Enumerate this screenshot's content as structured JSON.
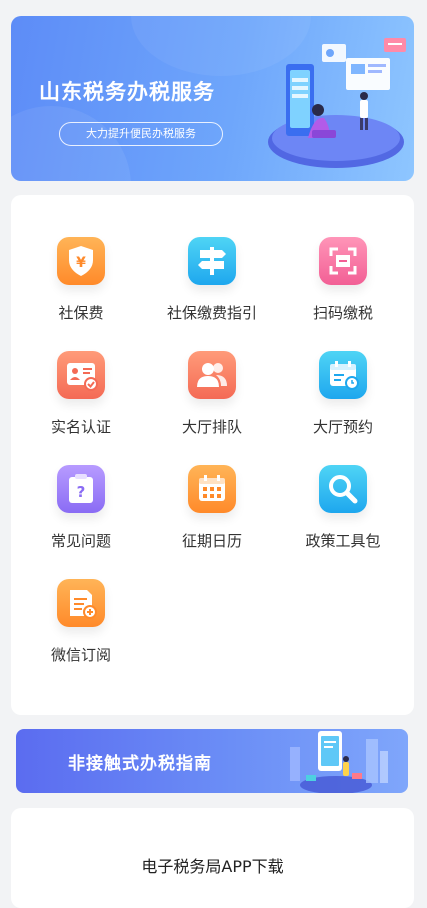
{
  "banner": {
    "title": "山东税务办税服务",
    "subtitle": "大力提升便民办税服务"
  },
  "services": [
    {
      "label": "社保费",
      "icon": "shield-yuan-icon",
      "color": "#ff9a3c"
    },
    {
      "label": "社保缴费指引",
      "icon": "signpost-icon",
      "color": "#2bb6f0"
    },
    {
      "label": "扫码缴税",
      "icon": "scan-icon",
      "color": "#f46fa0"
    },
    {
      "label": "实名认证",
      "icon": "id-card-icon",
      "color": "#f5785e"
    },
    {
      "label": "大厅排队",
      "icon": "people-icon",
      "color": "#f5785e"
    },
    {
      "label": "大厅预约",
      "icon": "calendar-clock-icon",
      "color": "#2bb6f0"
    },
    {
      "label": "常见问题",
      "icon": "question-icon",
      "color": "#9a7df8"
    },
    {
      "label": "征期日历",
      "icon": "calendar-icon",
      "color": "#ff9a3c"
    },
    {
      "label": "政策工具包",
      "icon": "magnifier-icon",
      "color": "#2bb6f0"
    },
    {
      "label": "微信订阅",
      "icon": "subscribe-doc-icon",
      "color": "#ff9a3c"
    }
  ],
  "guide": {
    "title": "非接触式办税指南"
  },
  "app_download": {
    "title": "电子税务局APP下载"
  }
}
